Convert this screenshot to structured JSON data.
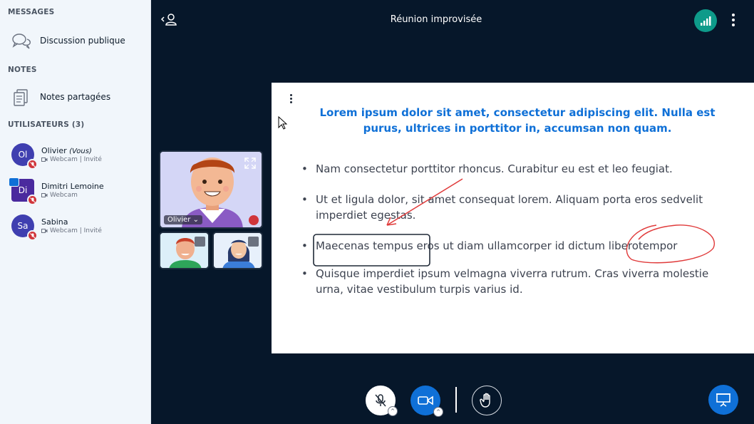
{
  "sidebar": {
    "messages_title": "MESSAGES",
    "public_chat": "Discussion publique",
    "notes_title": "NOTES",
    "shared_notes": "Notes partagées",
    "users_title": "UTILISATEURS (3)",
    "users": [
      {
        "initials": "Ol",
        "name": "Olivier",
        "you": "(Vous)",
        "status": "Webcam | Invité",
        "color": "#3f3fb0"
      },
      {
        "initials": "Di",
        "name": "Dimitri Lemoine",
        "you": "",
        "status": "Webcam",
        "color": "#4a2a9e"
      },
      {
        "initials": "Sa",
        "name": "Sabina",
        "you": "",
        "status": "Webcam | Invité",
        "color": "#3f3fb0"
      }
    ]
  },
  "header": {
    "title": "Réunion improvisée"
  },
  "video": {
    "main_name": "Olivier"
  },
  "slide": {
    "title": "Lorem ipsum dolor sit amet, consectetur adipiscing elit. Nulla est purus, ultrices in porttitor in, accumsan non quam.",
    "bullets": [
      "Nam consectetur porttitor rhoncus. Curabitur eu est et leo feugiat.",
      "Ut et ligula dolor, sit amet consequat lorem. Aliquam porta eros sedvelit imperdiet egestas.",
      "Maecenas tempus eros ut diam ullamcorper id dictum liberotempor",
      "Quisque imperdiet ipsum velmagna viverra rutrum. Cras viverra molestie urna, vitae vestibulum turpis varius id."
    ]
  },
  "colors": {
    "accent": "#0f70d7",
    "background": "#06172a",
    "mute": "#d0353b",
    "connection": "#0e9b8a"
  },
  "icons": [
    "chat-icon",
    "notes-icon",
    "user-list-icon",
    "signal-icon",
    "more-vertical-icon",
    "expand-icon",
    "mic-off-icon",
    "camera-icon",
    "hand-icon",
    "presentation-icon"
  ]
}
